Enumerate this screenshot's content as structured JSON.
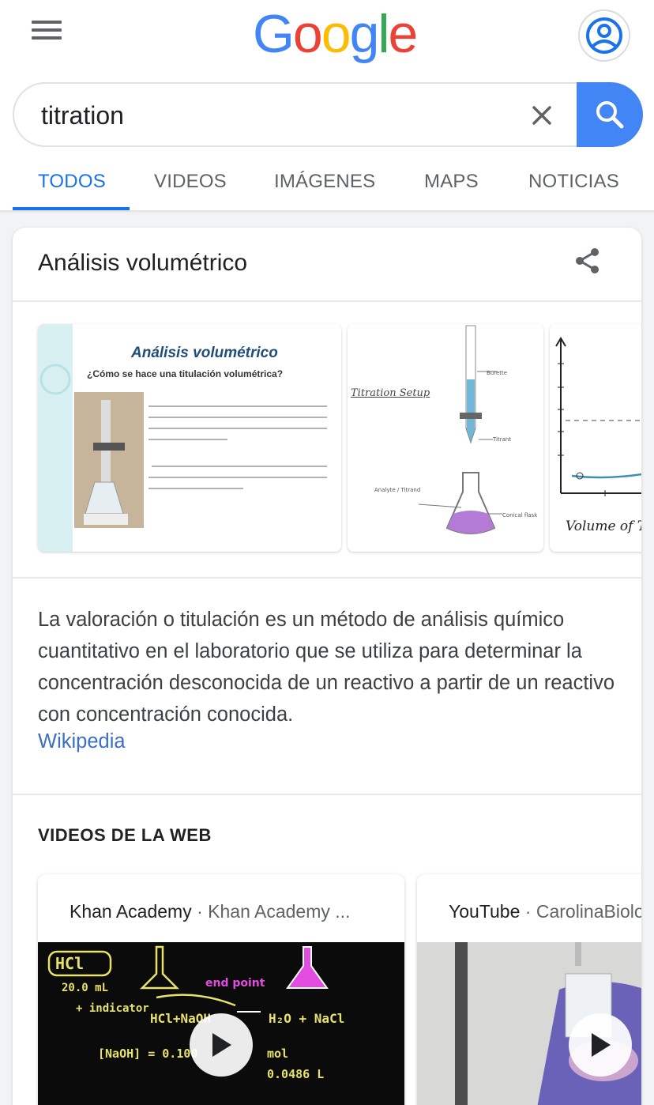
{
  "header": {
    "logo": [
      "G",
      "o",
      "o",
      "g",
      "l",
      "e"
    ]
  },
  "search": {
    "query": "titration"
  },
  "tabs": [
    {
      "label": "TODOS"
    },
    {
      "label": "VIDEOS"
    },
    {
      "label": "IMÁGENES"
    },
    {
      "label": "MAPS"
    },
    {
      "label": "NOTICIAS"
    }
  ],
  "knowledge_panel": {
    "title": "Análisis volumétrico",
    "images": [
      {
        "heading": "Análisis volumétrico",
        "subheading": "¿Cómo se hace una titulación volumétrica?"
      },
      {
        "heading": "Titration Setup"
      },
      {
        "axis_label": "Volume of T"
      }
    ],
    "description": "La valoración o titulación es un método de análisis químico cuantitativo en el laboratorio que se utiliza para determinar la concentración desconocida de un reactivo a partir de un reactivo con concentración conocida.",
    "source": "Wikipedia"
  },
  "videos": {
    "heading": "VIDEOS DE LA WEB",
    "items": [
      {
        "platform": "Khan Academy",
        "channel": "Khan Academy ..."
      },
      {
        "platform": "YouTube",
        "channel": "CarolinaBiolog"
      }
    ]
  },
  "colors": {
    "accent": "#1a73e8",
    "search_button": "#4285f4",
    "link": "#3b6fc4"
  }
}
